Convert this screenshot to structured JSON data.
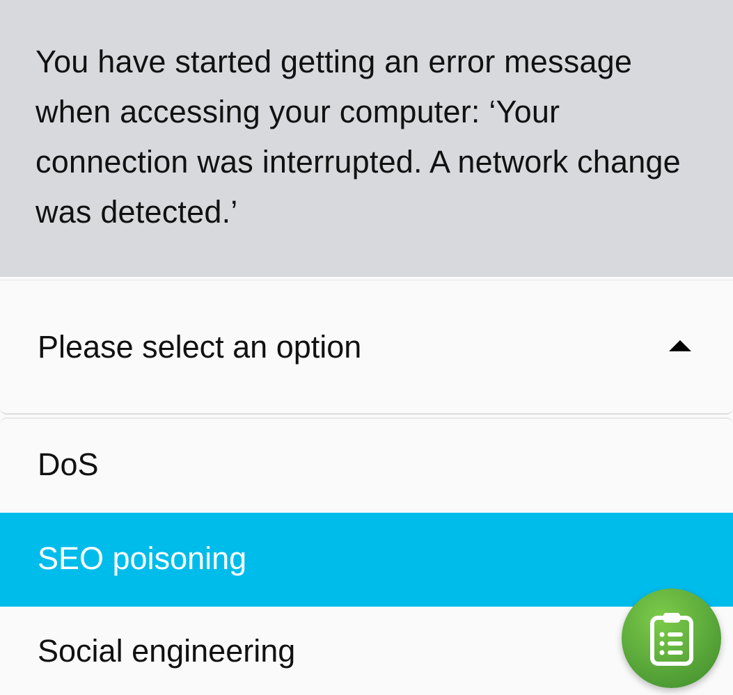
{
  "question": {
    "text": "You have started getting an error message when accessing your computer: ‘Your connection was interrupted. A network change was detected.’"
  },
  "dropdown": {
    "placeholder": "Please select an option",
    "expanded": true,
    "caret_icon": "caret-up-icon",
    "options": [
      {
        "label": "DoS",
        "selected": false
      },
      {
        "label": "SEO poisoning",
        "selected": true
      },
      {
        "label": "Social engineering",
        "selected": false
      }
    ]
  },
  "colors": {
    "question_bg": "#d8d9dd",
    "selected_bg": "#00bceb",
    "fab_green": "#5aa83a"
  },
  "fab": {
    "icon": "clipboard-list-icon"
  }
}
